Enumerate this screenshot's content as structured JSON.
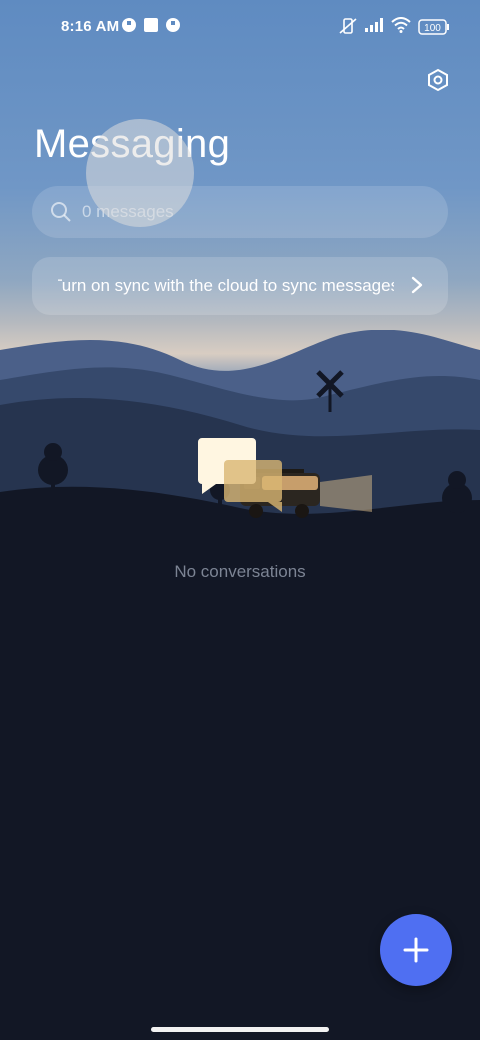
{
  "status_bar": {
    "time": "8:16 AM",
    "battery": "100",
    "icons": [
      "app-notification-icon",
      "square-notification-icon",
      "app-notification-icon",
      "vibrate-mute-icon",
      "signal-icon",
      "wifi-icon",
      "battery-icon"
    ]
  },
  "header": {
    "title": "Messaging",
    "settings_icon": "settings-hexagon-icon"
  },
  "search": {
    "placeholder": "0 messages",
    "icon": "search-icon"
  },
  "sync_banner": {
    "text": "Turn on sync with the cloud to sync messages",
    "icon": "chevron-right-icon"
  },
  "empty_state": {
    "text": "No conversations"
  },
  "fab": {
    "icon": "plus-icon"
  },
  "colors": {
    "accent": "#4f6ff2",
    "background": "#121725"
  }
}
